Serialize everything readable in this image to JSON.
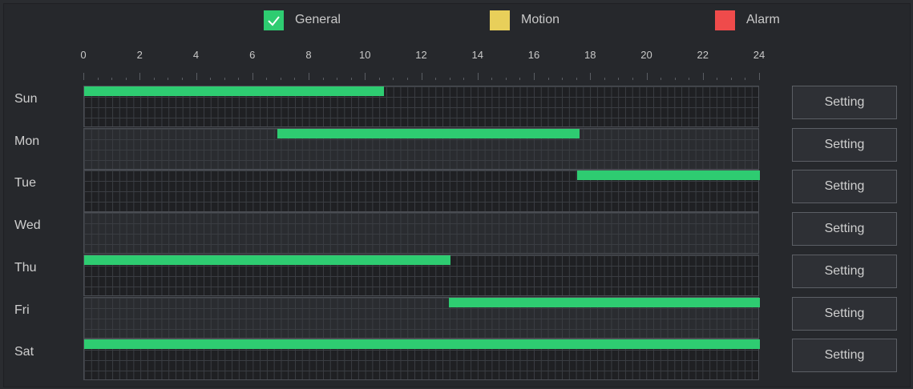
{
  "legend": [
    {
      "label": "General",
      "color": "#2ecc71",
      "checked": true
    },
    {
      "label": "Motion",
      "color": "#e8cf5a",
      "checked": false
    },
    {
      "label": "Alarm",
      "color": "#ef4b4b",
      "checked": false
    }
  ],
  "hours": [
    "0",
    "2",
    "4",
    "6",
    "8",
    "10",
    "12",
    "14",
    "16",
    "18",
    "20",
    "22",
    "24"
  ],
  "days": [
    {
      "label": "Sun",
      "setting_label": "Setting",
      "segments": [
        [
          0,
          10.65
        ]
      ]
    },
    {
      "label": "Mon",
      "setting_label": "Setting",
      "segments": [
        [
          6.85,
          17.6
        ]
      ]
    },
    {
      "label": "Tue",
      "setting_label": "Setting",
      "segments": [
        [
          17.5,
          24
        ]
      ]
    },
    {
      "label": "Wed",
      "setting_label": "Setting",
      "segments": []
    },
    {
      "label": "Thu",
      "setting_label": "Setting",
      "segments": [
        [
          0,
          13
        ]
      ]
    },
    {
      "label": "Fri",
      "setting_label": "Setting",
      "segments": [
        [
          12.95,
          24
        ]
      ]
    },
    {
      "label": "Sat",
      "setting_label": "Setting",
      "segments": [
        [
          0,
          24
        ]
      ]
    }
  ]
}
